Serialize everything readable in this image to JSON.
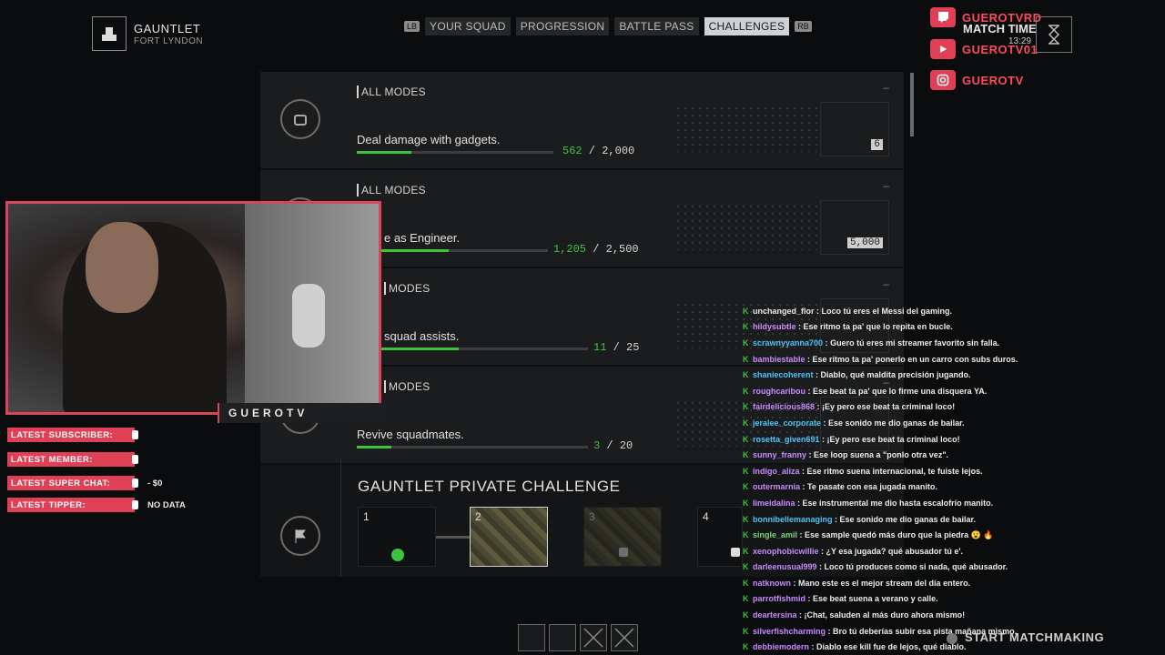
{
  "header": {
    "mode_title": "GAUNTLET",
    "mode_subtitle": "FORT LYNDON",
    "lb_key": "LB",
    "rb_key": "RB",
    "tabs": [
      {
        "label": "YOUR SQUAD",
        "active": false
      },
      {
        "label": "PROGRESSION",
        "active": false
      },
      {
        "label": "BATTLE PASS",
        "active": false
      },
      {
        "label": "CHALLENGES",
        "active": true
      }
    ],
    "match_time_label": "MATCH TIME",
    "match_time_value": "13:29"
  },
  "socials": {
    "twitch": "GUEROTVRD",
    "youtube": "GUEROTV01",
    "instagram": "GUEROTV"
  },
  "challenges": [
    {
      "mode": "ALL MODES",
      "description": "Deal damage with gadgets.",
      "current": "562",
      "goal": "2,000",
      "progress": 0.28,
      "reward": "6"
    },
    {
      "mode": "ALL MODES",
      "description": "e as Engineer.",
      "current": "1,205",
      "goal": "2,500",
      "progress": 0.48,
      "reward": "5,000"
    },
    {
      "mode": "MODES",
      "description": "squad assists.",
      "current": "11",
      "goal": "25",
      "progress": 0.44,
      "reward": ""
    },
    {
      "mode": "MODES",
      "description": "Revive squadmates.",
      "current": "3",
      "goal": "20",
      "progress": 0.15,
      "reward": ""
    }
  ],
  "private_challenge": {
    "title": "GAUNTLET PRIVATE CHALLENGE",
    "slots": [
      "1",
      "2",
      "3",
      "4"
    ]
  },
  "stream": {
    "streamer_name": "GUEROTV",
    "latest": [
      {
        "label": "LATEST SUBSCRIBER:",
        "value": ""
      },
      {
        "label": "LATEST MEMBER:",
        "value": ""
      },
      {
        "label": "LATEST SUPER CHAT:",
        "value": "- $0"
      },
      {
        "label": "LATEST TIPPER:",
        "value": "NO DATA"
      }
    ]
  },
  "chat": [
    {
      "user": "unchanged_flor",
      "color": "#e8e8e8",
      "text": "Loco tú eres el Messi del gaming."
    },
    {
      "user": "hildysubtle",
      "color": "#c98bff",
      "text": "Ese ritmo ta pa' que lo repita en bucle."
    },
    {
      "user": "scrawnyyanna700",
      "color": "#4fc3f7",
      "text": "Guero tú eres mi streamer favorito sin falla."
    },
    {
      "user": "bambiestable",
      "color": "#c98bff",
      "text": "Ese ritmo ta pa' ponerlo en un carro con subs duros."
    },
    {
      "user": "shaniecoherent",
      "color": "#4fc3f7",
      "text": "Diablo, qué maldita precisión jugando."
    },
    {
      "user": "roughcaribou",
      "color": "#c98bff",
      "text": "Ese beat ta pa' que lo firme una disquera YA."
    },
    {
      "user": "fairdelicious868",
      "color": "#c98bff",
      "text": "¡Ey pero ese beat ta criminal loco!"
    },
    {
      "user": "jeralee_corporate",
      "color": "#4fc3f7",
      "text": "Ese sonido me dio ganas de bailar."
    },
    {
      "user": "rosetta_given691",
      "color": "#4fc3f7",
      "text": "¡Ey pero ese beat ta criminal loco!"
    },
    {
      "user": "sunny_franny",
      "color": "#c98bff",
      "text": "Ese loop suena a \"ponlo otra vez\"."
    },
    {
      "user": "indigo_aliza",
      "color": "#c98bff",
      "text": "Ese ritmo suena internacional, te fuiste lejos."
    },
    {
      "user": "outermarnia",
      "color": "#c98bff",
      "text": "Te pasate con esa jugada manito."
    },
    {
      "user": "limeidalina",
      "color": "#c98bff",
      "text": "Ese instrumental me dio hasta escalofrío manito."
    },
    {
      "user": "bonnibellemanaging",
      "color": "#4fc3f7",
      "text": "Ese sonido me dio ganas de bailar."
    },
    {
      "user": "single_amil",
      "color": "#7bd67b",
      "text": "Ese sample quedó más duro que la piedra 😮 🔥"
    },
    {
      "user": "xenophobicwillie",
      "color": "#c98bff",
      "text": "¿Y esa jugada? qué abusador tú e'."
    },
    {
      "user": "darleenusual999",
      "color": "#c98bff",
      "text": "Loco tú produces como si nada, qué abusador."
    },
    {
      "user": "natknown",
      "color": "#c98bff",
      "text": "Mano este es el mejor stream del día entero."
    },
    {
      "user": "parrotfishmid",
      "color": "#c98bff",
      "text": "Ese beat suena a verano y calle."
    },
    {
      "user": "deartersina",
      "color": "#c98bff",
      "text": "¡Chat, saluden al más duro ahora mismo!"
    },
    {
      "user": "silverfishcharming",
      "color": "#c98bff",
      "text": "Bro tú deberías subir esa pista mañana mismo."
    },
    {
      "user": "debbiemodern",
      "color": "#c98bff",
      "text": "Diablo ese kill fue de lejos, qué diablo."
    }
  ],
  "footer": {
    "start_label": "START MATCHMAKING"
  }
}
